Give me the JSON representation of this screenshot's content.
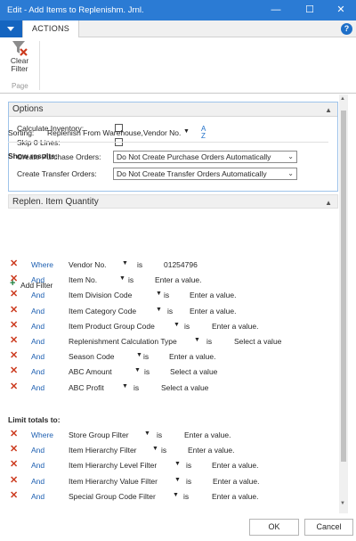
{
  "window": {
    "title": "Edit - Add Items to Replenishm. Jrnl."
  },
  "ribbon": {
    "tab": "ACTIONS",
    "clear_filter_line1": "Clear",
    "clear_filter_line2": "Filter",
    "group": "Page"
  },
  "options": {
    "header": "Options",
    "calc_inventory_label": "Calculate Inventory:",
    "skip_zero_lines_label": "Skip 0 Lines:",
    "create_po_label": "Create Purchase Orders:",
    "create_po_value": "Do Not Create Purchase Orders Automatically",
    "create_to_label": "Create Transfer Orders:",
    "create_to_value": "Do Not Create Transfer Orders Automatically"
  },
  "replen": {
    "header": "Replen. Item Quantity",
    "sorting_label": "Sorting:",
    "sorting_value": "Replenish From Warehouse,Vendor No.",
    "sort_icon_top": "A",
    "sort_icon_bottom": "Z",
    "show_results_label": "Show results:",
    "filters": [
      {
        "op": "Where",
        "field": "Vendor No.",
        "is": "is",
        "value": "01254796"
      },
      {
        "op": "And",
        "field": "Item No.",
        "is": "is",
        "value": "Enter a value."
      },
      {
        "op": "And",
        "field": "Item Division Code",
        "is": "is",
        "value": "Enter a value."
      },
      {
        "op": "And",
        "field": "Item Category Code",
        "is": "is",
        "value": "Enter a value."
      },
      {
        "op": "And",
        "field": "Item Product Group Code",
        "is": "is",
        "value": "Enter a value."
      },
      {
        "op": "And",
        "field": "Replenishment Calculation Type",
        "is": "is",
        "value": "Select a value"
      },
      {
        "op": "And",
        "field": "Season Code",
        "is": "is",
        "value": "Enter a value."
      },
      {
        "op": "And",
        "field": "ABC Amount",
        "is": "is",
        "value": "Select a value"
      },
      {
        "op": "And",
        "field": "ABC Profit",
        "is": "is",
        "value": "Select a value"
      }
    ],
    "add_filter": "Add Filter",
    "limit_totals_label": "Limit totals to:",
    "limit_filters": [
      {
        "op": "Where",
        "field": "Store Group Filter",
        "is": "is",
        "value": "Enter a value."
      },
      {
        "op": "And",
        "field": "Item Hierarchy Filter",
        "is": "is",
        "value": "Enter a value."
      },
      {
        "op": "And",
        "field": "Item Hierarchy Level Filter",
        "is": "is",
        "value": "Enter a value."
      },
      {
        "op": "And",
        "field": "Item Hierarchy Value Filter",
        "is": "is",
        "value": "Enter a value."
      },
      {
        "op": "And",
        "field": "Special Group Code Filter",
        "is": "is",
        "value": "Enter a value."
      }
    ]
  },
  "footer": {
    "ok": "OK",
    "cancel": "Cancel"
  },
  "colors": {
    "titlebar": "#2b7bd4",
    "remove_x": "#cc3b1f",
    "operator": "#1d5fb1",
    "add": "#1a7f3c"
  }
}
